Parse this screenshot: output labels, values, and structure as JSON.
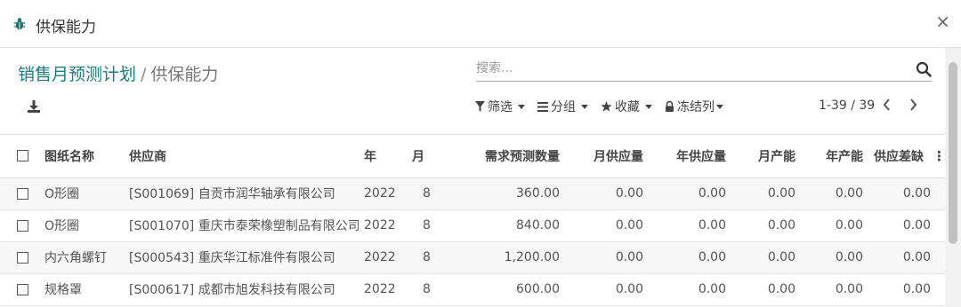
{
  "dialog": {
    "title": "供保能力",
    "close_glyph": "×"
  },
  "breadcrumb": {
    "parent": "销售月预测计划",
    "separator": "/",
    "current": "供保能力"
  },
  "search": {
    "placeholder": "搜索..."
  },
  "filters": {
    "filter_label": "筛选",
    "group_label": "分组",
    "favorite_label": "收藏",
    "freeze_label": "冻结列"
  },
  "pager": {
    "range": "1-39 / 39",
    "prev_glyph": "‹",
    "next_glyph": "›"
  },
  "table": {
    "columns": [
      "图纸名称",
      "供应商",
      "年",
      "月",
      "需求预测数量",
      "月供应量",
      "年供应量",
      "月产能",
      "年产能",
      "供应差缺"
    ],
    "rows": [
      [
        "O形圈",
        "[S001069] 自贡市润华轴承有限公司",
        "2022",
        "8",
        "360.00",
        "0.00",
        "0.00",
        "0.00",
        "0.00",
        "0.00"
      ],
      [
        "O形圈",
        "[S001070] 重庆市泰荣橡塑制品有限公司",
        "2022",
        "8",
        "840.00",
        "0.00",
        "0.00",
        "0.00",
        "0.00",
        "0.00"
      ],
      [
        "内六角螺钉",
        "[S000543] 重庆华江标准件有限公司",
        "2022",
        "8",
        "1,200.00",
        "0.00",
        "0.00",
        "0.00",
        "0.00",
        "0.00"
      ],
      [
        "规格罩",
        "[S000617] 成都市旭发科技有限公司",
        "2022",
        "8",
        "600.00",
        "0.00",
        "0.00",
        "0.00",
        "0.00",
        "0.00"
      ]
    ],
    "column_menu_glyph": "⋮"
  },
  "icons": {
    "title": "bug-icon",
    "download": "download-icon",
    "search": "search-icon",
    "filter": "funnel-icon",
    "group": "bars-icon",
    "favorite": "star-icon",
    "freeze": "lock-icon"
  },
  "colors": {
    "accent": "#1f7a7a"
  }
}
